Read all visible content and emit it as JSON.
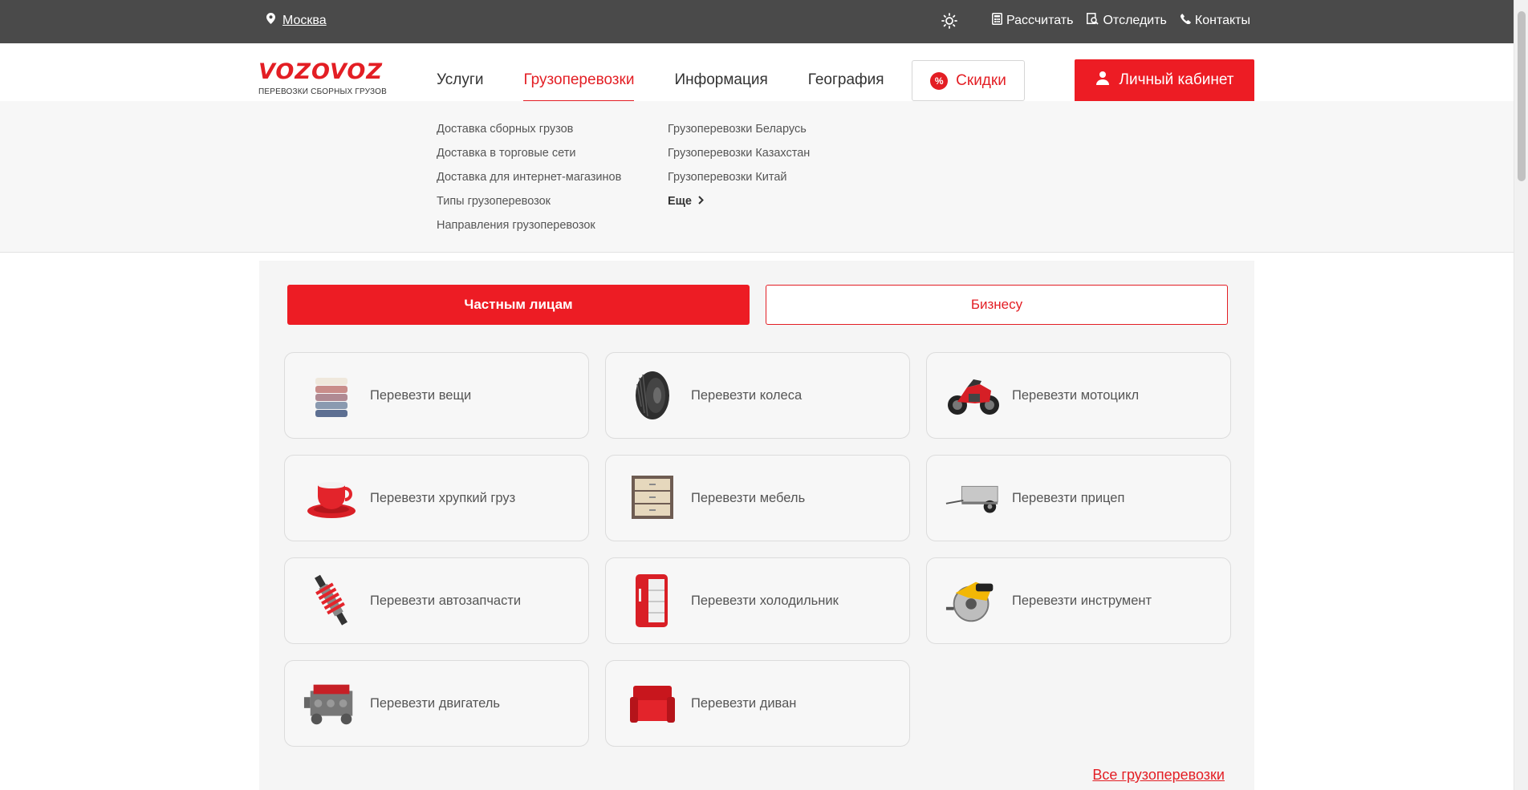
{
  "topbar": {
    "city": "Москва",
    "theme_toggle": "sun-icon",
    "calc_label": "Рассчитать",
    "track_label": "Отследить",
    "contacts_label": "Контакты"
  },
  "header": {
    "logo_brand": "VOZOVOZ",
    "logo_tagline": "ПЕРЕВОЗКИ СБОРНЫХ ГРУЗОВ",
    "nav": [
      "Услуги",
      "Грузоперевозки",
      "Информация",
      "География"
    ],
    "active_nav": "Грузоперевозки",
    "discount_label": "Скидки",
    "discount_icon_text": "%",
    "cabinet_label": "Личный кабинет"
  },
  "submenu": {
    "col1": [
      "Доставка сборных грузов",
      "Доставка в торговые сети",
      "Доставка для интернет-магазинов",
      "Типы грузоперевозок",
      "Направления грузоперевозок"
    ],
    "col2": [
      "Грузоперевозки Беларусь",
      "Грузоперевозки Казахстан",
      "Грузоперевозки Китай"
    ],
    "more_label": "Еще"
  },
  "main": {
    "tab_private": "Частным лицам",
    "tab_business": "Бизнесу",
    "cards": [
      {
        "label": "Перевезти вещи",
        "icon": "towels-icon"
      },
      {
        "label": "Перевезти колеса",
        "icon": "tire-icon"
      },
      {
        "label": "Перевезти мотоцикл",
        "icon": "motorcycle-icon"
      },
      {
        "label": "Перевезти хрупкий груз",
        "icon": "cup-icon"
      },
      {
        "label": "Перевезти мебель",
        "icon": "dresser-icon"
      },
      {
        "label": "Перевезти прицеп",
        "icon": "trailer-icon"
      },
      {
        "label": "Перевезти автозапчасти",
        "icon": "shock-absorber-icon"
      },
      {
        "label": "Перевезти холодильник",
        "icon": "fridge-icon"
      },
      {
        "label": "Перевезти инструмент",
        "icon": "circular-saw-icon"
      },
      {
        "label": "Перевезти двигатель",
        "icon": "engine-icon"
      },
      {
        "label": "Перевезти диван",
        "icon": "sofa-icon"
      }
    ],
    "all_link": "Все грузоперевозки"
  },
  "colors": {
    "accent": "#ed1c24",
    "topbar": "#4a4a4a"
  }
}
